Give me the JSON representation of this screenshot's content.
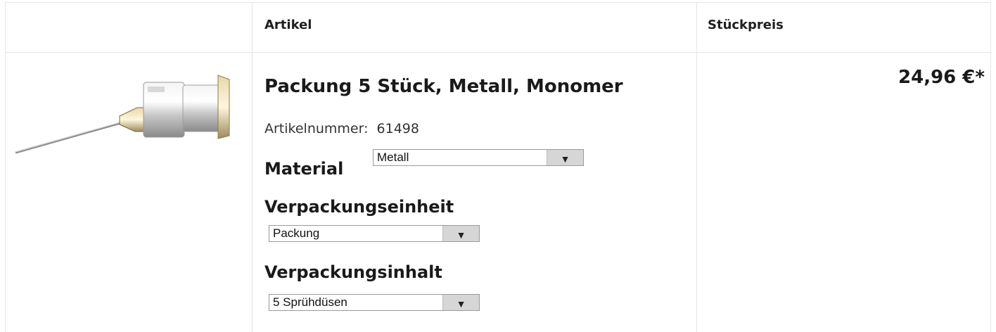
{
  "table": {
    "headers": {
      "artikel": "Artikel",
      "stueckpreis": "Stückpreis"
    }
  },
  "product": {
    "title": "Packung 5 Stück, Metall, Monomer",
    "article_number_label": "Artikelnummer:",
    "article_number": "61498",
    "image_icon": "spray-nozzle-needle",
    "price": "24,96 €*"
  },
  "options": {
    "material": {
      "label": "Material",
      "value": "Metall"
    },
    "verpackungseinheit": {
      "label": "Verpackungseinheit",
      "value": "Packung"
    },
    "verpackungsinhalt": {
      "label": "Verpackungsinhalt",
      "value": "5 Sprühdüsen"
    }
  },
  "colors": {
    "border": "#e6e6e6",
    "text": "#1a1a1a",
    "select_button": "#d6d6d6"
  }
}
